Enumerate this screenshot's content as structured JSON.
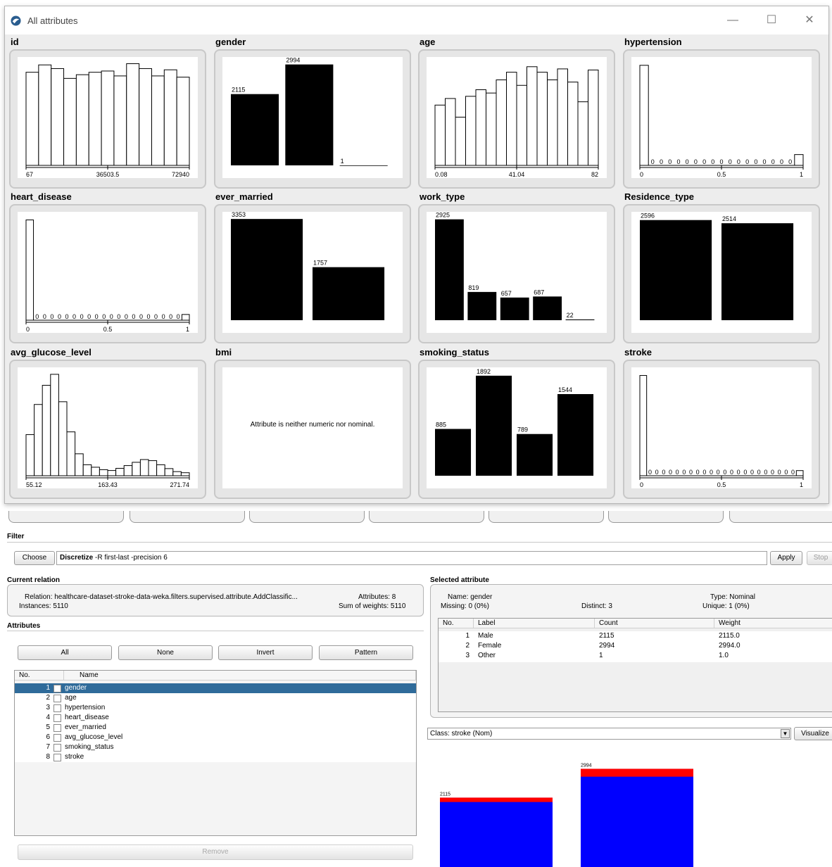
{
  "window": {
    "title": "All attributes",
    "controls": {
      "minimize": "—",
      "maximize": "☐",
      "close": "✕"
    },
    "message_bmi": "Attribute is neither numeric nor nominal."
  },
  "colors": {
    "bar": "#000000",
    "class_blue": "#0000ff",
    "class_red": "#ff0000",
    "selected_row": "#2f6b9a"
  },
  "chart_data": [
    {
      "name": "id",
      "type": "bar",
      "kind": "numeric-hist",
      "values": [
        76,
        82,
        79,
        71,
        74,
        76,
        77,
        73,
        83,
        79,
        73,
        78,
        72
      ],
      "ymax": 85,
      "axis_labels": [
        "67",
        "36503.5",
        "72940"
      ]
    },
    {
      "name": "gender",
      "type": "bar",
      "kind": "nominal",
      "values": [
        2115,
        2994,
        1
      ],
      "labels": [
        "2115",
        "2994",
        "1"
      ],
      "ymax": 3090
    },
    {
      "name": "age",
      "type": "bar",
      "kind": "numeric-hist",
      "values": [
        55,
        61,
        44,
        63,
        69,
        66,
        78,
        85,
        73,
        90,
        85,
        78,
        88,
        76,
        58,
        87
      ],
      "ymax": 95,
      "axis_labels": [
        "0.08",
        "41.04",
        "82"
      ]
    },
    {
      "name": "hypertension",
      "type": "bar",
      "kind": "binary-zeros",
      "values": [
        4612,
        498
      ],
      "zero_count": 17,
      "ymax": 4800,
      "axis_labels": [
        "0",
        "0.5",
        "1"
      ]
    },
    {
      "name": "heart_disease",
      "type": "bar",
      "kind": "binary-zeros",
      "values": [
        4834,
        276
      ],
      "zero_count": 20,
      "ymax": 5020,
      "axis_labels": [
        "0",
        "0.5",
        "1"
      ]
    },
    {
      "name": "ever_married",
      "type": "bar",
      "kind": "nominal",
      "values": [
        3353,
        1757
      ],
      "labels": [
        "3353",
        "1757"
      ],
      "ymax": 3450
    },
    {
      "name": "work_type",
      "type": "bar",
      "kind": "nominal",
      "values": [
        2925,
        819,
        657,
        687,
        22
      ],
      "labels": [
        "2925",
        "819",
        "657",
        "687",
        "22"
      ],
      "ymax": 3020
    },
    {
      "name": "Residence_type",
      "type": "bar",
      "kind": "nominal",
      "values": [
        2596,
        2514
      ],
      "labels": [
        "2596",
        "2514"
      ],
      "ymax": 2700
    },
    {
      "name": "avg_glucose_level",
      "type": "bar",
      "kind": "numeric-hist",
      "values": [
        300,
        520,
        660,
        740,
        540,
        320,
        160,
        80,
        62,
        44,
        38,
        54,
        74,
        98,
        118,
        110,
        80,
        52,
        30,
        22
      ],
      "ymax": 760,
      "axis_labels": [
        "55.12",
        "163.43",
        "271.74"
      ]
    },
    {
      "name": "bmi",
      "type": "table",
      "kind": "message"
    },
    {
      "name": "smoking_status",
      "type": "bar",
      "kind": "nominal",
      "values": [
        885,
        1892,
        789,
        1544
      ],
      "labels": [
        "885",
        "1892",
        "789",
        "1544"
      ],
      "ymax": 1970
    },
    {
      "name": "stroke",
      "type": "bar",
      "kind": "binary-zeros",
      "values": [
        4861,
        249
      ],
      "zero_count": 22,
      "ymax": 5050,
      "axis_labels": [
        "0",
        "0.5",
        "1"
      ]
    }
  ],
  "filter": {
    "header": "Filter",
    "choose": "Choose",
    "name": "Discretize",
    "options": " -R first-last -precision 6",
    "apply": "Apply",
    "stop": "Stop"
  },
  "relation": {
    "header": "Current relation",
    "relation_text": "Relation:  healthcare-dataset-stroke-data-weka.filters.supervised.attribute.AddClassific...",
    "instances_text": "Instances:  5110",
    "attributes_text": "Attributes:  8",
    "sumweights_text": "Sum of weights:  5110"
  },
  "attributes": {
    "header": "Attributes",
    "buttons": {
      "all": "All",
      "none": "None",
      "invert": "Invert",
      "pattern": "Pattern"
    },
    "col_no": "No.",
    "col_name": "Name",
    "rows": [
      {
        "no": "1",
        "name": "gender"
      },
      {
        "no": "2",
        "name": "age"
      },
      {
        "no": "3",
        "name": "hypertension"
      },
      {
        "no": "4",
        "name": "heart_disease"
      },
      {
        "no": "5",
        "name": "ever_married"
      },
      {
        "no": "6",
        "name": "avg_glucose_level"
      },
      {
        "no": "7",
        "name": "smoking_status"
      },
      {
        "no": "8",
        "name": "stroke"
      }
    ],
    "remove": "Remove"
  },
  "selected": {
    "header": "Selected attribute",
    "name_text": "Name:  gender",
    "missing_text": "Missing:  0 (0%)",
    "distinct_text": "Distinct:  3",
    "type_text": "Type:  Nominal",
    "unique_text": "Unique:  1 (0%)",
    "cols": [
      "No.",
      "Label",
      "Count",
      "Weight"
    ],
    "rows": [
      {
        "no": "1",
        "label": "Male",
        "count": "2115",
        "weight": "2115.0"
      },
      {
        "no": "2",
        "label": "Female",
        "count": "2994",
        "weight": "2994.0"
      },
      {
        "no": "3",
        "label": "Other",
        "count": "1",
        "weight": "1.0"
      }
    ]
  },
  "class_select": {
    "value": "Class: stroke (Nom)",
    "visualize": "Visualize"
  },
  "class_chart": {
    "type": "bar",
    "bars": [
      {
        "label": "2115",
        "total": 2115,
        "red": 89
      },
      {
        "label": "2994",
        "total": 2994,
        "red": 160
      }
    ]
  }
}
